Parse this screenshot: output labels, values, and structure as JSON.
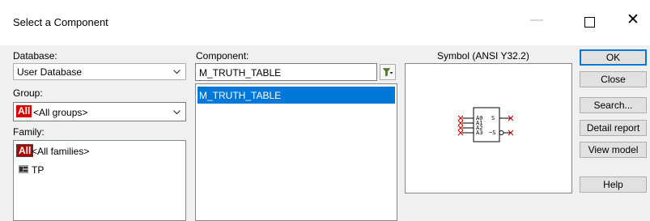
{
  "window": {
    "title": "Select a Component",
    "minimize": "—",
    "close": "✕"
  },
  "database": {
    "label": "Database:",
    "value": "User Database"
  },
  "group": {
    "label": "Group:",
    "badge": "All",
    "value": "<All groups>"
  },
  "family": {
    "label": "Family:",
    "items": [
      {
        "badge": "All",
        "label": "<All families>"
      },
      {
        "badge": "TP",
        "label": "TP"
      }
    ]
  },
  "component": {
    "label": "Component:",
    "value": "M_TRUTH_TABLE",
    "list": [
      "M_TRUTH_TABLE"
    ]
  },
  "symbol": {
    "label": "Symbol (ANSI Y32.2)",
    "inputs": [
      "A0",
      "A1",
      "A2",
      "A3"
    ],
    "outputs": [
      "S",
      "~S"
    ]
  },
  "buttons": {
    "ok": "OK",
    "close": "Close",
    "search": "Search...",
    "detail_report": "Detail report",
    "view_model": "View model",
    "help": "Help"
  },
  "colors": {
    "selection": "#0078d7",
    "all_badge": "#d80000",
    "symbol_pin": "#cc0000"
  }
}
